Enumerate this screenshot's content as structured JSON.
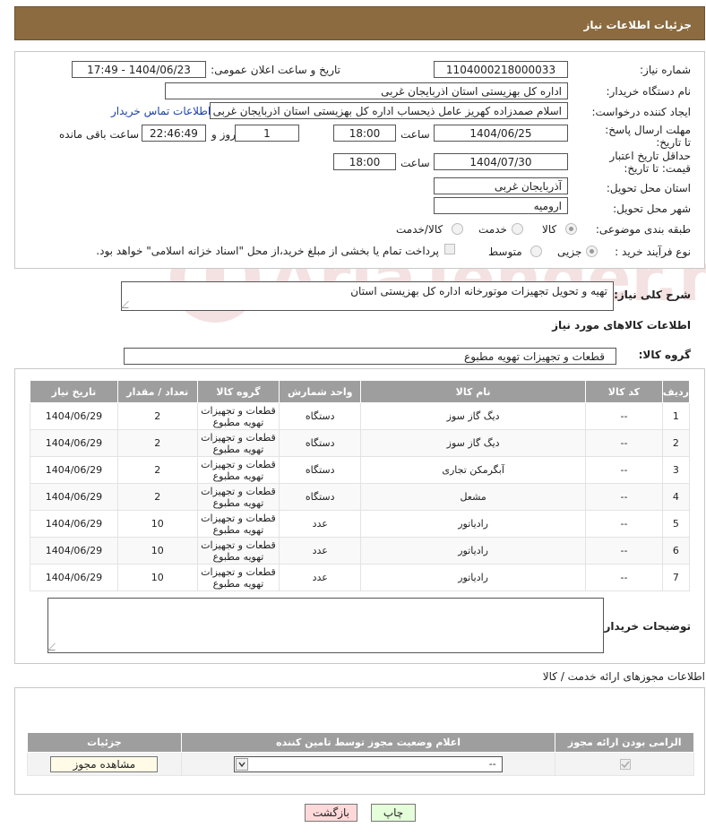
{
  "header": {
    "title": "جزئیات اطلاعات نیاز"
  },
  "form": {
    "need_number": {
      "label": "شماره نیاز:",
      "value": "1104000218000033"
    },
    "announce": {
      "label": "تاریخ و ساعت اعلان عمومی:",
      "value": "1404/06/23 - 17:49"
    },
    "buyer": {
      "label": "نام دستگاه خریدار:",
      "value": "اداره کل بهزیستی استان اذربایجان غربی"
    },
    "creator": {
      "label": "ایجاد کننده درخواست:",
      "value": "اسلام صمدزاده کهریز عامل ذیحساب اداره کل بهزیستی استان اذربایجان غربی",
      "contact_link": "اطلاعات تماس خریدار"
    },
    "deadline": {
      "label": "مهلت ارسال پاسخ: تا تاریخ:",
      "date": "1404/06/25",
      "time_label": "ساعت",
      "time": "18:00",
      "days": "1",
      "days_label": "روز و",
      "remaining": "22:46:49",
      "remaining_label": "ساعت باقی مانده"
    },
    "validity": {
      "label": "حداقل تاریخ اعتبار قیمت: تا تاریخ:",
      "date": "1404/07/30",
      "time_label": "ساعت",
      "time": "18:00"
    },
    "province": {
      "label": "استان محل تحویل:",
      "value": "آذربایجان غربی"
    },
    "city": {
      "label": "شهر محل تحویل:",
      "value": "ارومیه"
    },
    "category": {
      "label": "طبقه بندی موضوعی:",
      "options": [
        "کالا",
        "خدمت",
        "کالا/خدمت"
      ],
      "selected": "کالا"
    },
    "process": {
      "label": "نوع فرآیند خرید :",
      "options": [
        "جزیی",
        "متوسط"
      ],
      "selected": "جزیی",
      "note": "پرداخت تمام یا بخشی از مبلغ خرید،از محل \"اسناد خزانه اسلامی\" خواهد بود."
    }
  },
  "description": {
    "label": "شرح کلی نیاز:",
    "value": "تهیه و تحویل تجهیزات موتورخانه اداره کل بهزیستی استان"
  },
  "goods": {
    "section_title": "اطلاعات کالاهای مورد نیاز",
    "group_label": "گروه کالا:",
    "group_value": "قطعات و تجهیزات تهویه مطبوع",
    "columns": [
      "ردیف",
      "کد کالا",
      "نام کالا",
      "واحد شمارش",
      "گروه کالا",
      "تعداد / مقدار",
      "تاریخ نیاز"
    ],
    "rows": [
      {
        "n": "1",
        "code": "--",
        "name": "دیگ گاز سوز",
        "unit": "دستگاه",
        "group": "قطعات و تجهیزات تهویه مطبوع",
        "qty": "2",
        "date": "1404/06/29"
      },
      {
        "n": "2",
        "code": "--",
        "name": "دیگ گاز سوز",
        "unit": "دستگاه",
        "group": "قطعات و تجهیزات تهویه مطبوع",
        "qty": "2",
        "date": "1404/06/29"
      },
      {
        "n": "3",
        "code": "--",
        "name": "آبگرمکن تجاری",
        "unit": "دستگاه",
        "group": "قطعات و تجهیزات تهویه مطبوع",
        "qty": "2",
        "date": "1404/06/29"
      },
      {
        "n": "4",
        "code": "--",
        "name": "مشعل",
        "unit": "دستگاه",
        "group": "قطعات و تجهیزات تهویه مطبوع",
        "qty": "2",
        "date": "1404/06/29"
      },
      {
        "n": "5",
        "code": "--",
        "name": "رادیاتور",
        "unit": "عدد",
        "group": "قطعات و تجهیزات تهویه مطبوع",
        "qty": "10",
        "date": "1404/06/29"
      },
      {
        "n": "6",
        "code": "--",
        "name": "رادیاتور",
        "unit": "عدد",
        "group": "قطعات و تجهیزات تهویه مطبوع",
        "qty": "10",
        "date": "1404/06/29"
      },
      {
        "n": "7",
        "code": "--",
        "name": "رادیاتور",
        "unit": "عدد",
        "group": "قطعات و تجهیزات تهویه مطبوع",
        "qty": "10",
        "date": "1404/06/29"
      }
    ]
  },
  "buyer_notes": {
    "label": "توضیحات خریدار:",
    "value": ""
  },
  "licenses": {
    "section_title": "اطلاعات مجوزهای ارائه خدمت / کالا",
    "columns": [
      "الزامی بودن ارائه مجوز",
      "اعلام وضعیت مجوز توسط تامین کننده",
      "جزئیات"
    ],
    "select_value": "--",
    "view_button": "مشاهده مجوز"
  },
  "footer": {
    "print": "چاپ",
    "back": "بازگشت"
  },
  "watermark": {
    "text": "AriaTender.neT"
  },
  "colors": {
    "header_bg": "#8b6b3f",
    "table_header": "#9e9e9e",
    "link": "#1a3fb0",
    "back_button": "#ffd9d9",
    "print_button": "#e4ffd9"
  }
}
